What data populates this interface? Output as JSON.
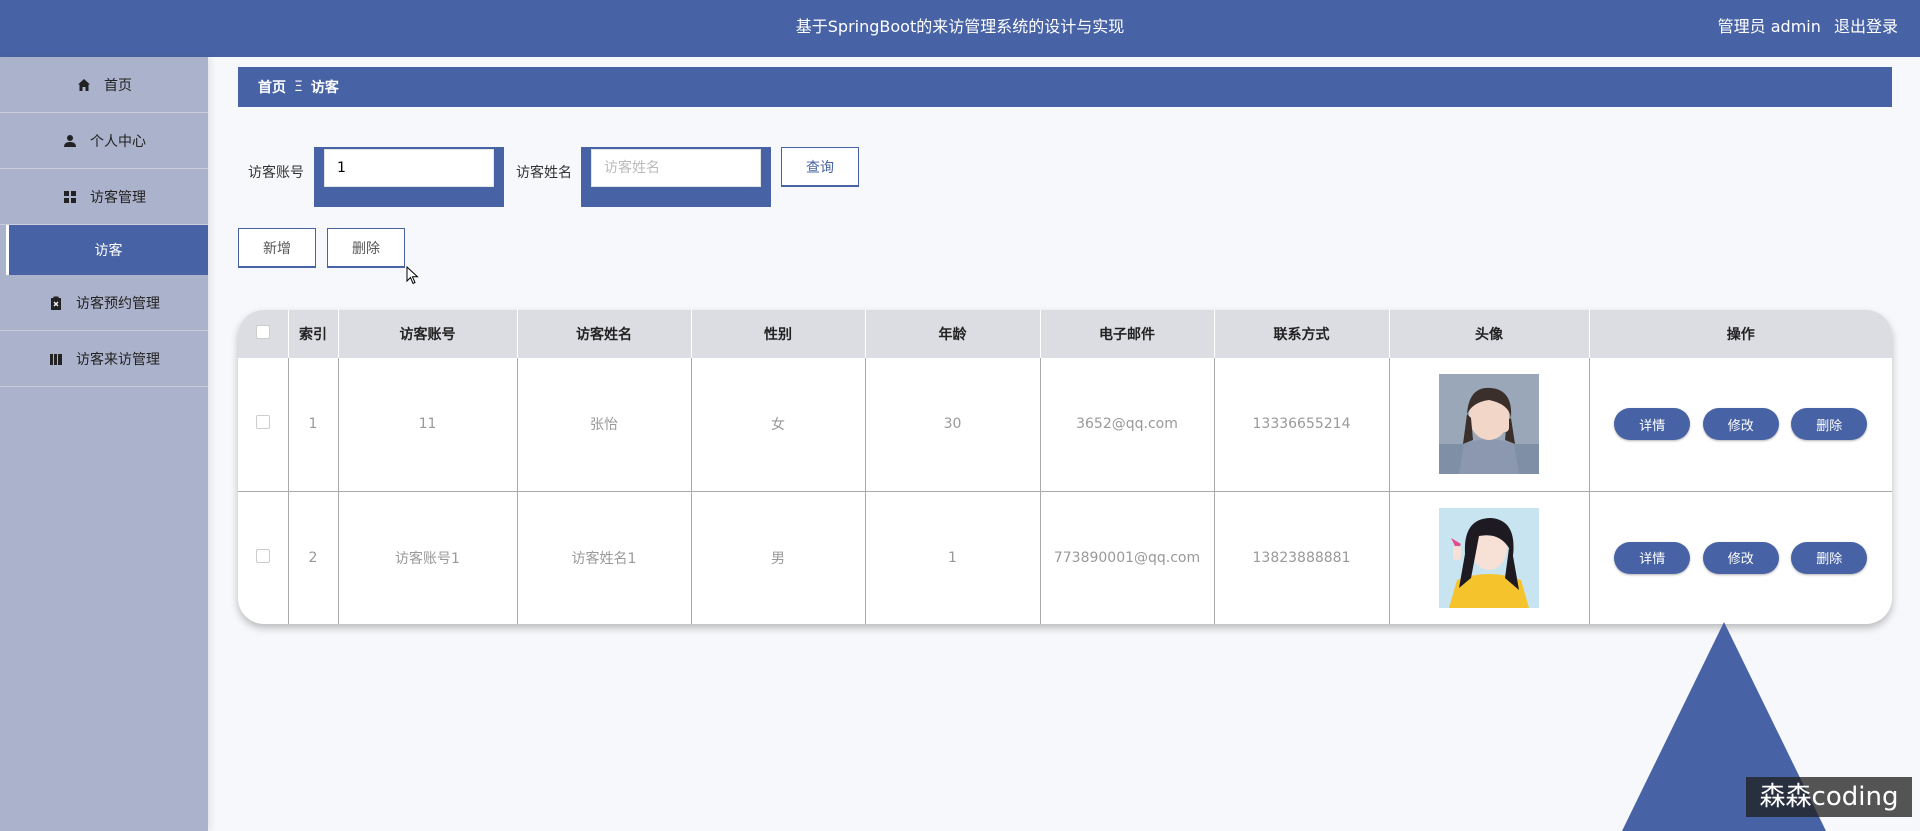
{
  "header": {
    "title": "基于SpringBoot的来访管理系统的设计与实现",
    "user_label": "管理员 admin",
    "logout_label": "退出登录"
  },
  "sidebar": {
    "items": [
      {
        "label": "首页",
        "icon": "home-icon"
      },
      {
        "label": "个人中心",
        "icon": "user-icon"
      },
      {
        "label": "访客管理",
        "icon": "grid-icon"
      },
      {
        "label": "访客",
        "icon": ""
      },
      {
        "label": "访客预约管理",
        "icon": "clipboard-icon"
      },
      {
        "label": "访客来访管理",
        "icon": "book-icon"
      }
    ]
  },
  "breadcrumb": {
    "home": "首页",
    "separator": "Ξ",
    "current": "访客"
  },
  "search": {
    "account_label": "访客账号",
    "account_value": "1",
    "name_label": "访客姓名",
    "name_placeholder": "访客姓名",
    "query_button": "查询"
  },
  "actions": {
    "add_button": "新增",
    "delete_button": "删除"
  },
  "table": {
    "headers": [
      "索引",
      "访客账号",
      "访客姓名",
      "性别",
      "年龄",
      "电子邮件",
      "联系方式",
      "头像",
      "操作"
    ],
    "rows": [
      {
        "index": "1",
        "account": "11",
        "name": "张怡",
        "gender": "女",
        "age": "30",
        "email": "3652@qq.com",
        "phone": "13336655214"
      },
      {
        "index": "2",
        "account": "访客账号1",
        "name": "访客姓名1",
        "gender": "男",
        "age": "1",
        "email": "773890001@qq.com",
        "phone": "13823888881"
      }
    ],
    "row_buttons": {
      "detail": "详情",
      "edit": "修改",
      "delete": "删除"
    }
  },
  "watermark": "森森coding",
  "colors": {
    "accent": "#4863a5",
    "sidebar": "#abb2cb"
  }
}
